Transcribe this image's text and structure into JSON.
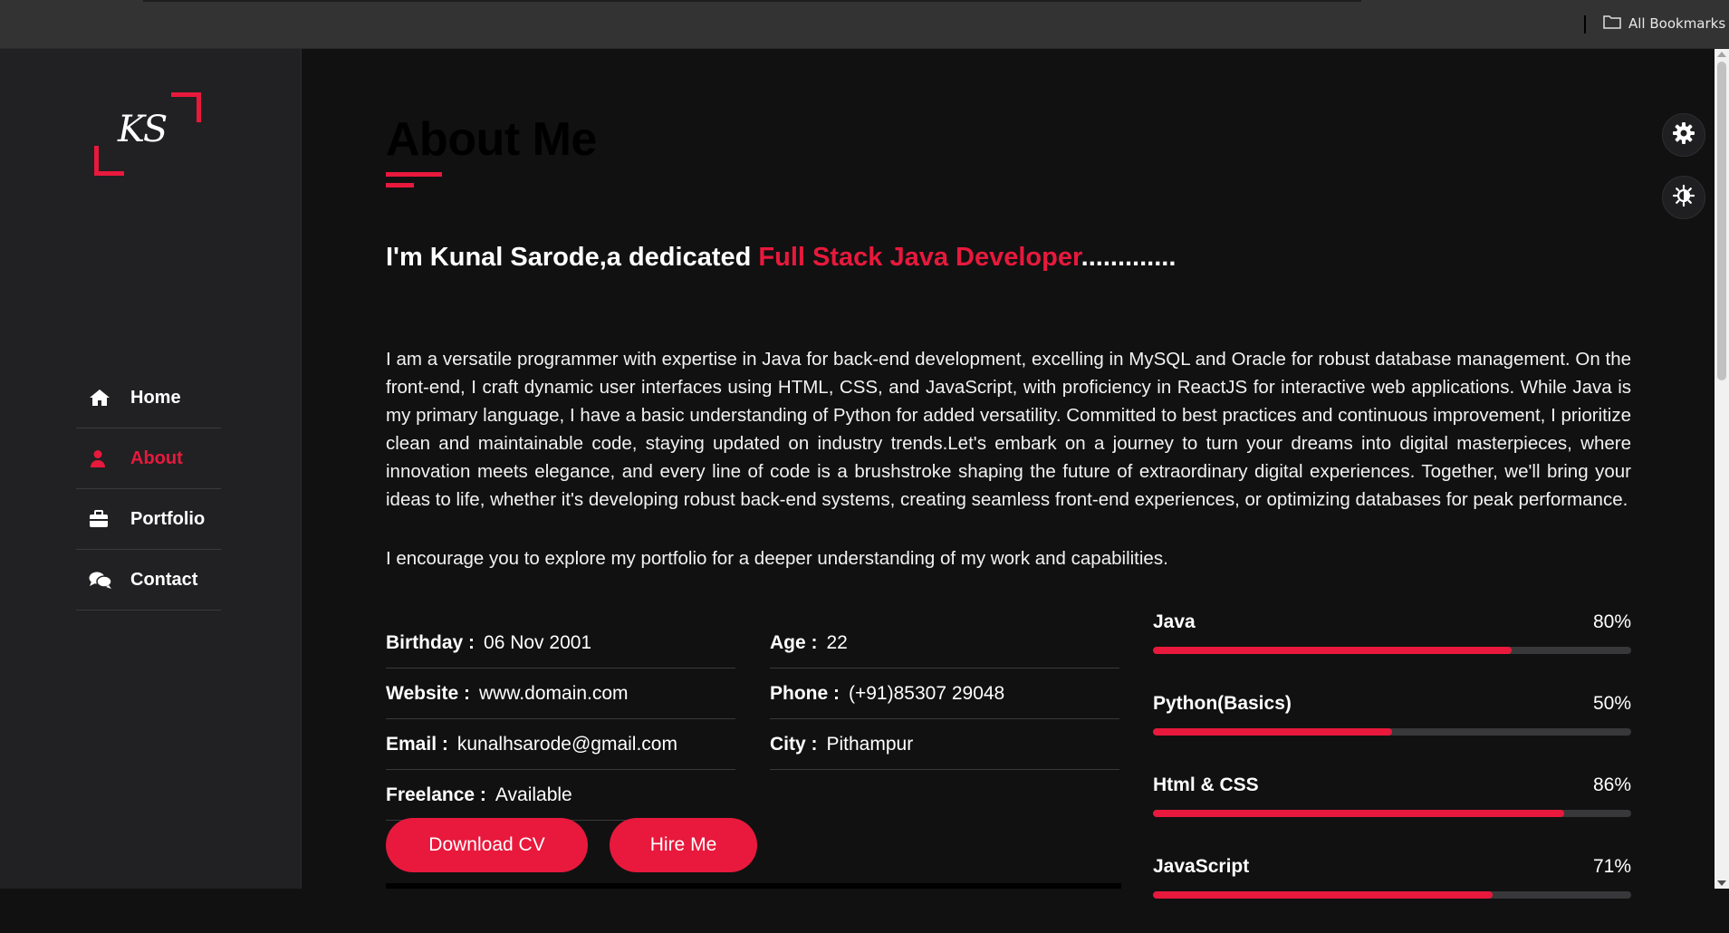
{
  "browser": {
    "bookmarks_label": "All Bookmarks"
  },
  "sidebar": {
    "logo_text": "KS",
    "nav": [
      {
        "label": "Home",
        "icon": "home-icon",
        "active": false
      },
      {
        "label": "About",
        "icon": "user-icon",
        "active": true
      },
      {
        "label": "Portfolio",
        "icon": "briefcase-icon",
        "active": false
      },
      {
        "label": "Contact",
        "icon": "chat-icon",
        "active": false
      }
    ]
  },
  "about": {
    "title": "About Me",
    "intro_prefix": "I'm Kunal Sarode,a dedicated ",
    "intro_accent": "Full Stack Java Developer",
    "intro_suffix": ".............",
    "paragraph": "I am a versatile programmer with expertise in Java for back-end development, excelling in MySQL and Oracle for robust database management. On the front-end, I craft dynamic user interfaces using HTML, CSS, and JavaScript, with proficiency in ReactJS for interactive web applications. While Java is my primary language, I have a basic understanding of Python for added versatility. Committed to best practices and continuous improvement, I prioritize clean and maintainable code, staying updated on industry trends.Let's embark on a journey to turn your dreams into digital masterpieces, where innovation meets elegance, and every line of code is a brushstroke shaping the future of extraordinary digital experiences. Together, we'll bring your ideas to life, whether it's developing robust back-end systems, creating seamless front-end experiences, or optimizing databases for peak performance.",
    "paragraph2": "I encourage you to explore my portfolio for a deeper understanding of my work and capabilities."
  },
  "info": {
    "left": [
      {
        "key": "Birthday :",
        "value": "06 Nov 2001"
      },
      {
        "key": "Website :",
        "value": "www.domain.com"
      },
      {
        "key": "Email :",
        "value": "kunalhsarode@gmail.com"
      },
      {
        "key": "Freelance :",
        "value": "Available"
      }
    ],
    "right": [
      {
        "key": "Age :",
        "value": "22"
      },
      {
        "key": "Phone :",
        "value": "(+91)85307 29048"
      },
      {
        "key": "City :",
        "value": "Pithampur"
      }
    ]
  },
  "buttons": {
    "download_cv": "Download CV",
    "hire_me": "Hire Me"
  },
  "skills": [
    {
      "name": "Java",
      "percent_label": "80%",
      "level": 0.75
    },
    {
      "name": "Python(Basics)",
      "percent_label": "50%",
      "level": 0.5
    },
    {
      "name": "Html & CSS",
      "percent_label": "86%",
      "level": 0.86
    },
    {
      "name": "JavaScript",
      "percent_label": "71%",
      "level": 0.71
    }
  ],
  "colors": {
    "accent": "#e8193c",
    "sidebar_bg": "#212123",
    "page_bg": "#111112"
  }
}
